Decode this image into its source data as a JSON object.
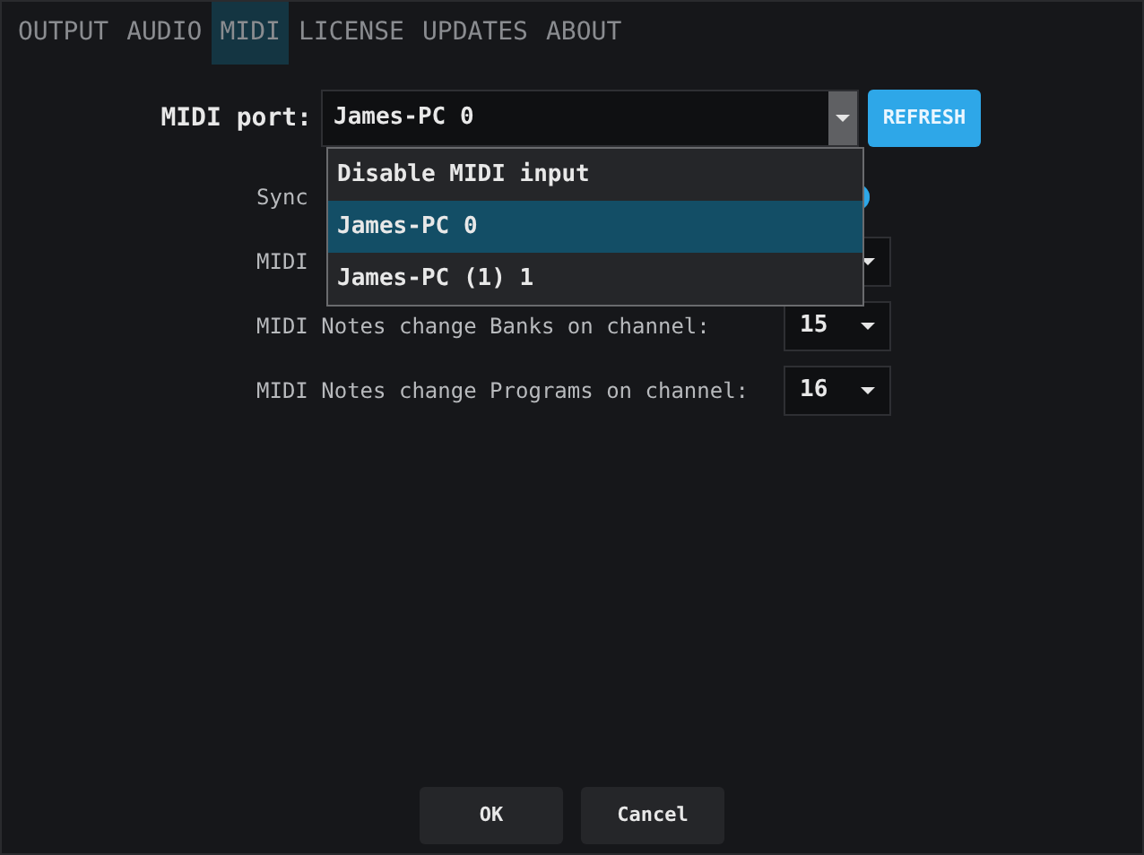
{
  "tabs": [
    {
      "label": "OUTPUT",
      "selected": false
    },
    {
      "label": "AUDIO",
      "selected": false
    },
    {
      "label": "MIDI",
      "selected": true
    },
    {
      "label": "LICENSE",
      "selected": false
    },
    {
      "label": "UPDATES",
      "selected": false
    },
    {
      "label": "ABOUT",
      "selected": false
    }
  ],
  "midi_port": {
    "label": "MIDI port:",
    "value": "James-PC 0",
    "refresh": "REFRESH",
    "expanded": true,
    "options": [
      {
        "label": "Disable MIDI input",
        "selected": false
      },
      {
        "label": "James-PC 0",
        "selected": true
      },
      {
        "label": "James-PC (1) 1",
        "selected": false
      }
    ]
  },
  "settings": [
    {
      "kind": "toggle",
      "label": "Sync",
      "on": true
    },
    {
      "kind": "select",
      "label": "MIDI"
    },
    {
      "kind": "select",
      "label": "MIDI Notes change Banks on channel:",
      "value": "15"
    },
    {
      "kind": "select",
      "label": "MIDI Notes change Programs on channel:",
      "value": "16"
    }
  ],
  "buttons": [
    "OK",
    "Cancel"
  ]
}
